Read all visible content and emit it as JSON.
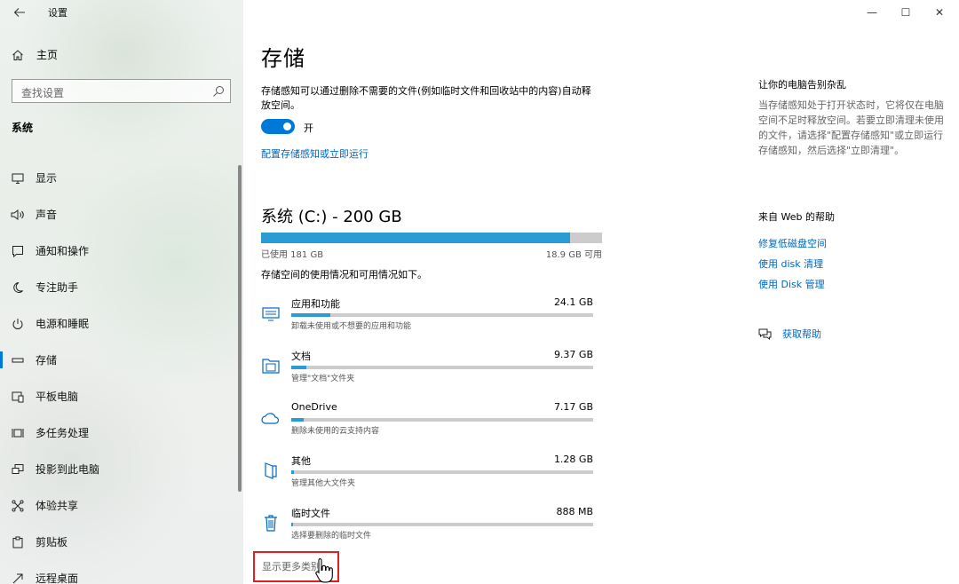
{
  "window": {
    "title": "设置",
    "minimize_glyph": "—",
    "maximize_glyph": "☐",
    "close_glyph": "✕"
  },
  "sidebar": {
    "home_label": "主页",
    "search_placeholder": "查找设置",
    "section_title": "系统",
    "items": [
      {
        "label": "显示",
        "icon": "monitor-icon"
      },
      {
        "label": "声音",
        "icon": "speaker-icon"
      },
      {
        "label": "通知和操作",
        "icon": "notification-icon"
      },
      {
        "label": "专注助手",
        "icon": "moon-icon"
      },
      {
        "label": "电源和睡眠",
        "icon": "power-icon"
      },
      {
        "label": "存储",
        "icon": "storage-icon",
        "active": true
      },
      {
        "label": "平板电脑",
        "icon": "tablet-icon"
      },
      {
        "label": "多任务处理",
        "icon": "multitask-icon"
      },
      {
        "label": "投影到此电脑",
        "icon": "project-icon"
      },
      {
        "label": "体验共享",
        "icon": "share-icon"
      },
      {
        "label": "剪贴板",
        "icon": "clipboard-icon"
      },
      {
        "label": "远程桌面",
        "icon": "remote-icon"
      }
    ]
  },
  "main": {
    "title": "存储",
    "description": "存储感知可以通过删除不需要的文件(例如临时文件和回收站中的内容)自动释放空间。",
    "toggle_state": "开",
    "config_link": "配置存储感知或立即运行",
    "drive_title": "系统 (C:) - 200 GB",
    "used_label": "已使用 181 GB",
    "available_label": "18.9 GB 可用",
    "drive_used_fraction": 0.905,
    "usage_description": "存储空间的使用情况和可用情况如下。",
    "categories": [
      {
        "name": "应用和功能",
        "size": "24.1 GB",
        "sub": "卸载未使用或不想要的应用和功能",
        "fraction": 0.13,
        "icon": "apps-icon"
      },
      {
        "name": "文档",
        "size": "9.37 GB",
        "sub": "管理\"文档\"文件夹",
        "fraction": 0.05,
        "icon": "documents-icon"
      },
      {
        "name": "OneDrive",
        "size": "7.17 GB",
        "sub": "删除未使用的云支持内容",
        "fraction": 0.04,
        "icon": "cloud-icon"
      },
      {
        "name": "其他",
        "size": "1.28 GB",
        "sub": "管理其他大文件夹",
        "fraction": 0.008,
        "icon": "other-icon"
      },
      {
        "name": "临时文件",
        "size": "888 MB",
        "sub": "选择要删除的临时文件",
        "fraction": 0.005,
        "icon": "trash-icon"
      }
    ],
    "show_more": "显示更多类别"
  },
  "right_panel": {
    "title": "让你的电脑告别杂乱",
    "text": "当存储感知处于打开状态时，它将仅在电脑空间不足时释放空间。若要立即清理未使用的文件，请选择\"配置存储感知\"或立即运行存储感知，然后选择\"立即清理\"。",
    "help_title": "来自 Web 的帮助",
    "help_links": [
      "修复低磁盘空间",
      "使用 disk 清理",
      "使用 Disk 管理"
    ],
    "feedback": "获取帮助"
  },
  "colors": {
    "accent": "#0078d7",
    "bar_fill": "#2b9bd6",
    "link": "#0067c0",
    "highlight": "#e02020"
  }
}
